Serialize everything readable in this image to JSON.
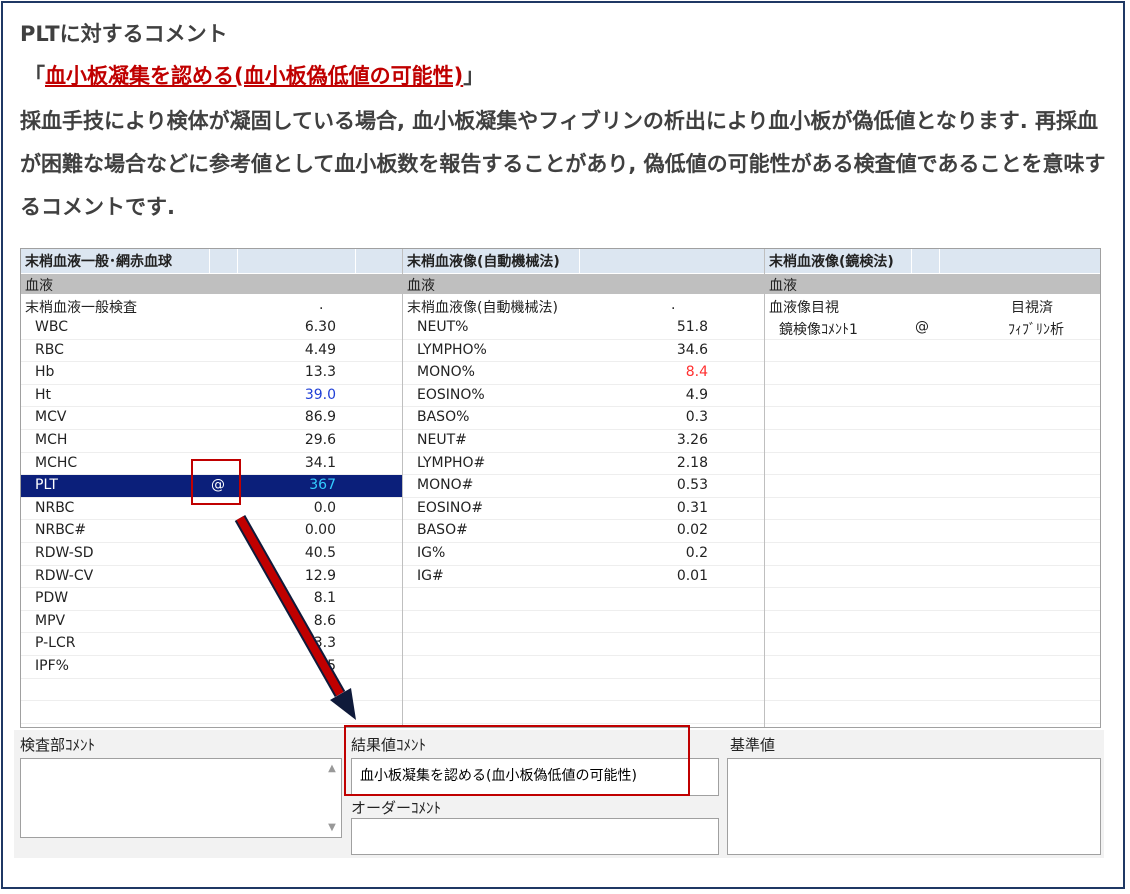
{
  "heading": "PLTに対するコメント",
  "quote_open": "「",
  "quote_text": "血小板凝集を認める(血小板偽低値の可能性)",
  "quote_close": "」",
  "paragraph": "採血手技により検体が凝固している場合, 血小板凝集やフィブリンの析出により血小板が偽低値となります. 再採血が困難な場合などに参考値として血小板数を報告することがあり, 偽低値の可能性がある検査値であることを意味するコメントです.",
  "panel": {
    "col1": {
      "title": "末梢血液一般･網赤血球",
      "specimen": "血液",
      "group": "末梢血液一般検査",
      "group_mark": ".",
      "rows": [
        {
          "name": "WBC",
          "value": "6.30"
        },
        {
          "name": "RBC",
          "value": "4.49"
        },
        {
          "name": "Hb",
          "value": "13.3"
        },
        {
          "name": "Ht",
          "value": "39.0"
        },
        {
          "name": "MCV",
          "value": "86.9"
        },
        {
          "name": "MCH",
          "value": "29.6"
        },
        {
          "name": "MCHC",
          "value": "34.1"
        },
        {
          "name": "PLT",
          "mark": "@",
          "value": "367"
        },
        {
          "name": "NRBC",
          "value": "0.0"
        },
        {
          "name": "NRBC#",
          "value": "0.00"
        },
        {
          "name": "RDW-SD",
          "value": "40.5"
        },
        {
          "name": "RDW-CV",
          "value": "12.9"
        },
        {
          "name": "PDW",
          "value": "8.1"
        },
        {
          "name": "MPV",
          "value": "8.6"
        },
        {
          "name": "P-LCR",
          "value": "3.3"
        },
        {
          "name": "IPF%",
          "value": "5"
        }
      ]
    },
    "col2": {
      "title": "末梢血液像(自動機械法)",
      "specimen": "血液",
      "group": "末梢血液像(自動機械法)",
      "group_mark": ".",
      "rows": [
        {
          "name": "NEUT%",
          "value": "51.8"
        },
        {
          "name": "LYMPHO%",
          "value": "34.6"
        },
        {
          "name": "MONO%",
          "value": "8.4"
        },
        {
          "name": "EOSINO%",
          "value": "4.9"
        },
        {
          "name": "BASO%",
          "value": "0.3"
        },
        {
          "name": "NEUT#",
          "value": "3.26"
        },
        {
          "name": "LYMPHO#",
          "value": "2.18"
        },
        {
          "name": "MONO#",
          "value": "0.53"
        },
        {
          "name": "EOSINO#",
          "value": "0.31"
        },
        {
          "name": "BASO#",
          "value": "0.02"
        },
        {
          "name": "IG%",
          "value": "0.2"
        },
        {
          "name": "IG#",
          "value": "0.01"
        }
      ]
    },
    "col3": {
      "title": "末梢血液像(鏡検法)",
      "specimen": "血液",
      "group": "血液像目視",
      "group_mark": "目視済",
      "rows": [
        {
          "name": "鏡検像ｺﾒﾝﾄ1",
          "mark": "@",
          "value": "ﾌｨﾌﾞﾘﾝ析"
        }
      ]
    }
  },
  "comments": {
    "lab_label": "検査部ｺﾒﾝﾄ",
    "result_label": "結果値ｺﾒﾝﾄ",
    "result_value": "血小板凝集を認める(血小板偽低値の可能性)",
    "order_label": "オーダーｺﾒﾝﾄ",
    "reference_label": "基準値"
  },
  "colors": {
    "selected_row": "#0b1f7a",
    "highlight": "#c00000",
    "header_blue": "#dce6f1",
    "value_blue": "#1f3fd6",
    "value_red": "#ff3030"
  }
}
